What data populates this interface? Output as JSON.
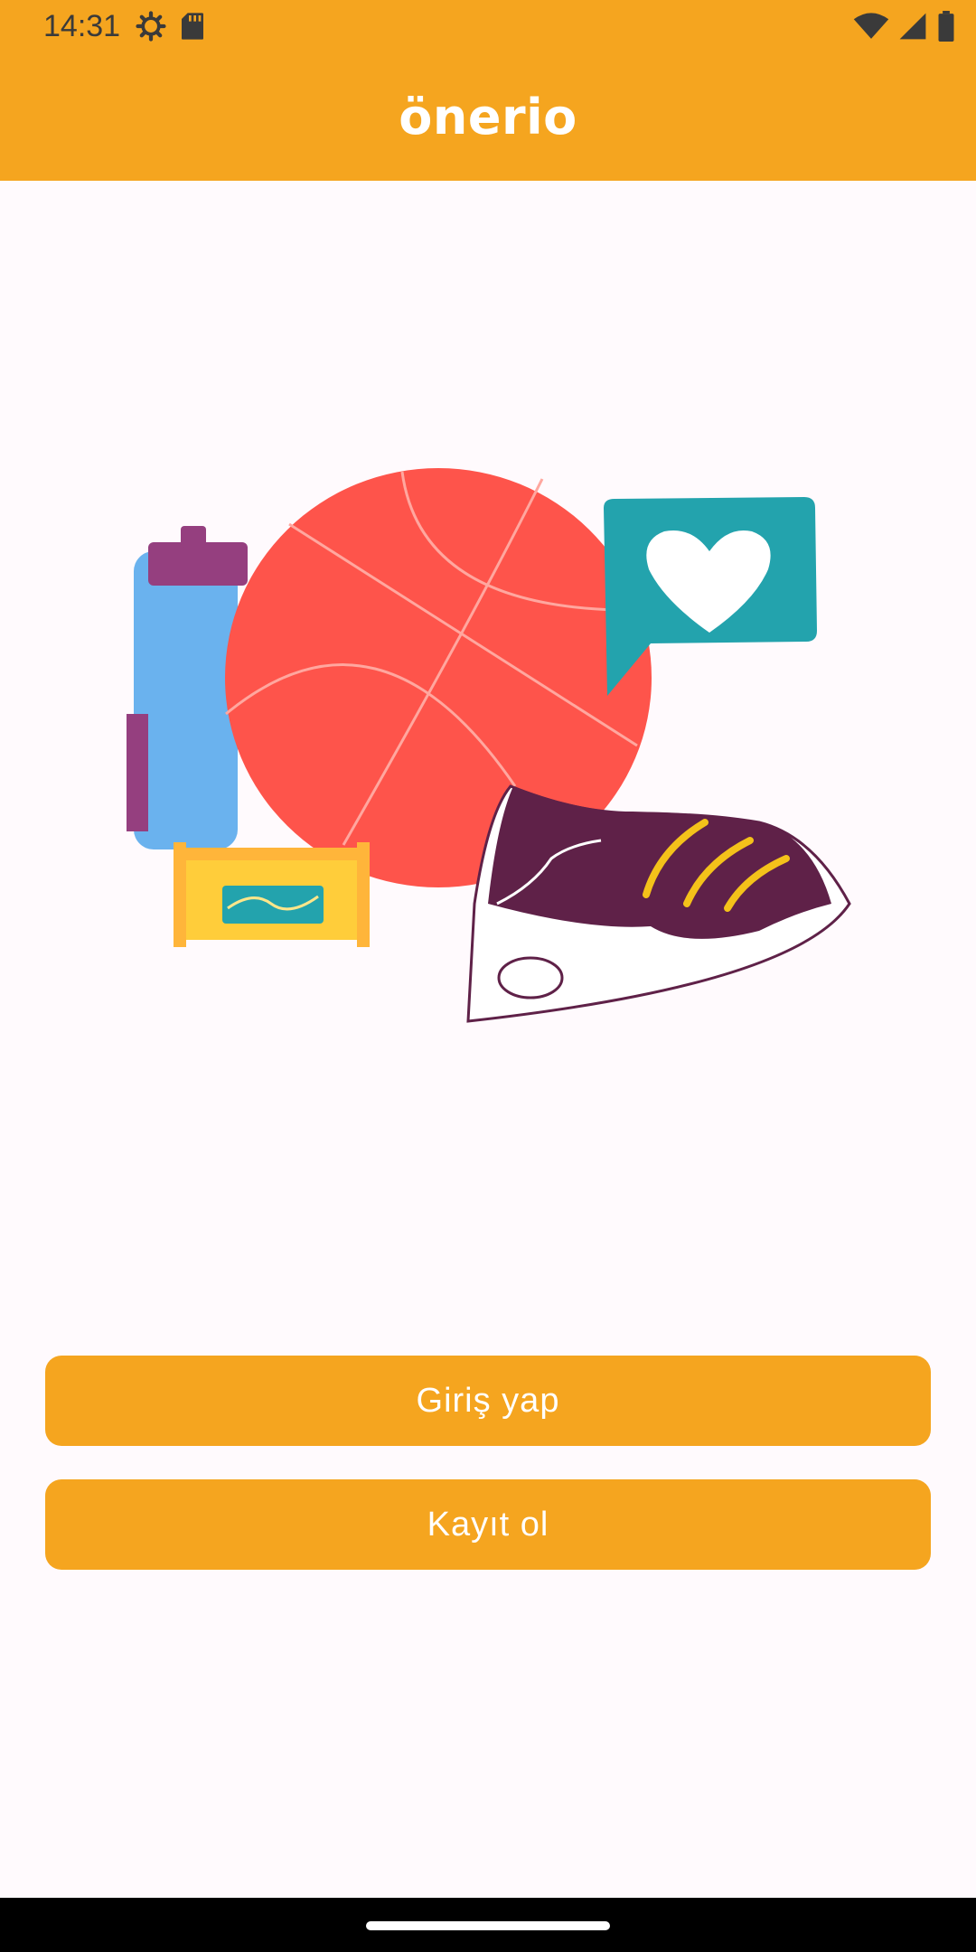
{
  "status_bar": {
    "time": "14:31",
    "left_icons": [
      "settings-gear-icon",
      "sd-card-icon"
    ],
    "right_icons": [
      "wifi-icon",
      "cellular-signal-icon",
      "battery-icon"
    ]
  },
  "app_bar": {
    "title": "önerio"
  },
  "hero_image": {
    "description_icons": [
      "water-bottle-icon",
      "basketball-icon",
      "heart-speech-bubble-icon",
      "energy-bar-icon",
      "sneaker-icon"
    ]
  },
  "buttons": {
    "login": "Giriş yap",
    "signup": "Kayıt ol"
  },
  "colors": {
    "accent": "#f5a51f",
    "background": "#fffafd",
    "basketball": "#fe544b",
    "bottle": "#6ab2ee",
    "bottle_cap": "#953f7f",
    "bubble": "#23a3ad",
    "energy_bar": "#ffcd3a",
    "shoe": "#5f2148"
  }
}
